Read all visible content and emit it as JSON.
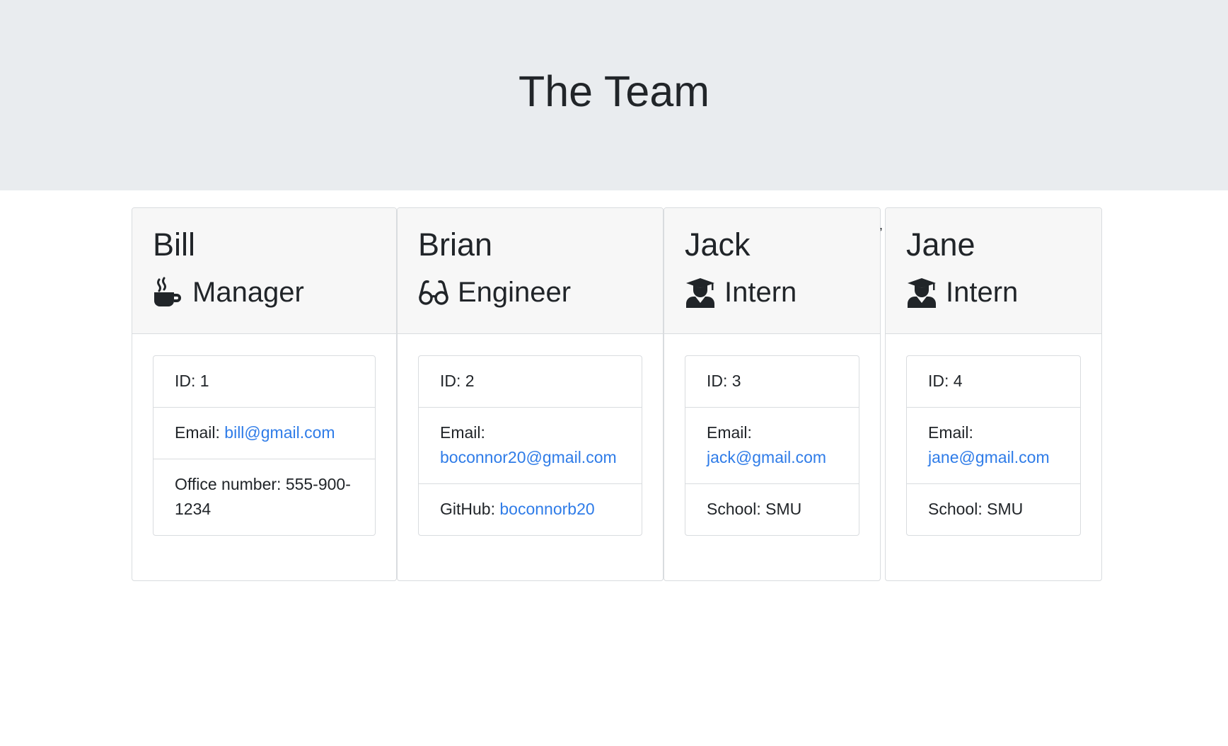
{
  "page": {
    "title": "The Team"
  },
  "colors": {
    "header_bg": "#e9ecef",
    "card_header_bg": "#f7f7f7",
    "link": "#2f7ce8",
    "text": "#212529"
  },
  "team": [
    {
      "name": "Bill",
      "role": "Manager",
      "role_icon": "mug-hot-icon",
      "id": "ID: 1",
      "email_label": "Email: ",
      "email": "bill@gmail.com",
      "extra_label": "Office number: ",
      "extra_value": "555-900-1234"
    },
    {
      "name": "Brian",
      "role": "Engineer",
      "role_icon": "glasses-icon",
      "id": "ID: 2",
      "email_label": "Email: ",
      "email": "boconnor20@gmail.com",
      "extra_label": "GitHub: ",
      "extra_value": "boconnorb20"
    },
    {
      "name": "Jack",
      "role": "Intern",
      "role_icon": "user-graduate-icon",
      "id": "ID: 3",
      "email_label": "Email: ",
      "email": "jack@gmail.com",
      "extra_label": "School: ",
      "extra_value": "SMU"
    },
    {
      "name": "Jane",
      "role": "Intern",
      "role_icon": "user-graduate-icon",
      "id": "ID: 4",
      "email_label": "Email: ",
      "email": "jane@gmail.com",
      "extra_label": "School: ",
      "extra_value": "SMU"
    }
  ],
  "stray_mark": ","
}
